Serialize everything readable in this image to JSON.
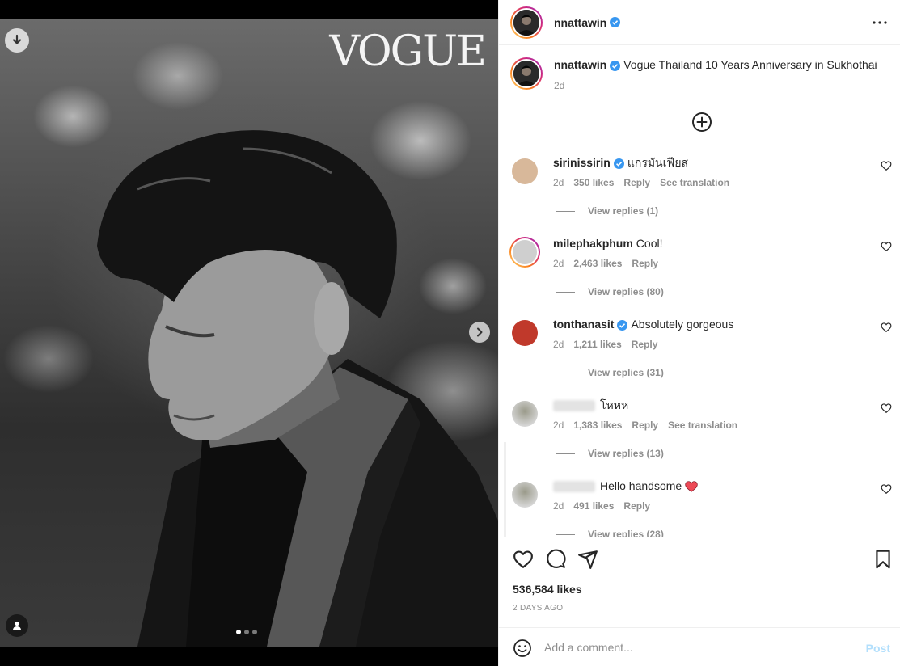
{
  "post": {
    "author": "nnattawin",
    "caption": "Vogue Thailand 10 Years Anniversary in Sukhothai",
    "caption_age": "2d",
    "likes": "536,584 likes",
    "date": "2 DAYS AGO"
  },
  "media": {
    "logo_text": "VOGUE",
    "carousel": {
      "count": 3,
      "active_index": 0
    },
    "icons": [
      "download-icon",
      "chevron-right-icon",
      "user-tag-icon"
    ]
  },
  "comments": [
    {
      "user": "sirinissirin",
      "verified": true,
      "text": "แกรมันเฟียส",
      "age": "2d",
      "likes": "350 likes",
      "reply": "Reply",
      "translation": "See translation",
      "view_replies": "View replies (1)",
      "avatar_color": "#d8b89a",
      "ring": false
    },
    {
      "user": "milephakphum",
      "verified": false,
      "text": "Cool!",
      "age": "2d",
      "likes": "2,463 likes",
      "reply": "Reply",
      "translation": "",
      "view_replies": "View replies (80)",
      "avatar_color": "#bdbdbd",
      "ring": true
    },
    {
      "user": "tonthanasit",
      "verified": true,
      "text": "Absolutely gorgeous",
      "age": "2d",
      "likes": "1,211 likes",
      "reply": "Reply",
      "translation": "",
      "view_replies": "View replies (31)",
      "avatar_color": "#c0392b",
      "ring": false
    },
    {
      "user": "",
      "verified": false,
      "text": "โหหห",
      "age": "2d",
      "likes": "1,383 likes",
      "reply": "Reply",
      "translation": "See translation",
      "view_replies": "View replies (13)",
      "avatar_color": "#8a8a7a",
      "ring": false
    },
    {
      "user": "",
      "verified": false,
      "text": "Hello handsome",
      "age": "2d",
      "likes": "491 likes",
      "reply": "Reply",
      "translation": "",
      "view_replies": "View replies (28)",
      "avatar_color": "#555555",
      "ring": false
    }
  ],
  "composer": {
    "placeholder": "Add a comment...",
    "post_label": "Post"
  },
  "colors": {
    "verified": "#3897f0",
    "muted": "#8e8e8e",
    "post_disabled": "#b2dffc",
    "heart_emoji": "#ed4956"
  }
}
